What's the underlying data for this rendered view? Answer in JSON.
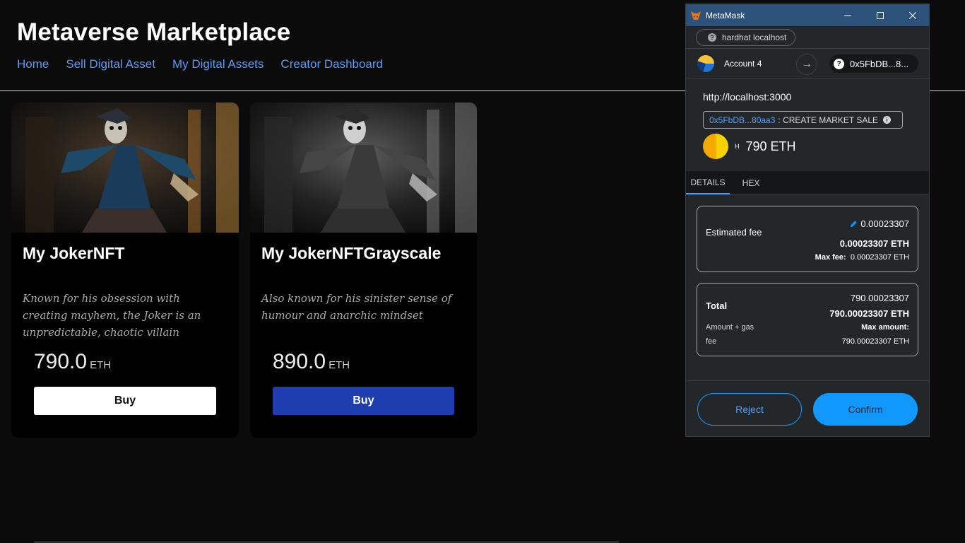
{
  "site": {
    "title": "Metaverse Marketplace",
    "nav": [
      "Home",
      "Sell Digital Asset",
      "My Digital Assets",
      "Creator Dashboard"
    ]
  },
  "cards": [
    {
      "name": "My JokerNFT",
      "description": "Known for his obsession with creating mayhem, the Joker is an unpredictable, chaotic villain",
      "price": "790.0",
      "unit": "ETH",
      "buy_label": "Buy"
    },
    {
      "name": "My JokerNFTGrayscale",
      "description": "Also known for his sinister sense of humour and anarchic mindset",
      "price": "890.0",
      "unit": "ETH",
      "buy_label": "Buy"
    }
  ],
  "metamask": {
    "window_title": "MetaMask",
    "network": "hardhat localhost",
    "from_account": "Account 4",
    "to_address": "0x5FbDB...8...",
    "origin": "http://localhost:3000",
    "method_address": "0x5FbDB...80aa3",
    "method_name": ": CREATE MARKET SALE",
    "value_prefix": "H",
    "value_amount": "790 ETH",
    "tabs": [
      "DETAILS",
      "HEX"
    ],
    "estimated_fee": {
      "label": "Estimated fee",
      "value": "0.00023307",
      "value_eth": "0.00023307 ETH",
      "max_fee_label": "Max fee:",
      "max_fee_value": "0.00023307 ETH"
    },
    "total": {
      "label": "Total",
      "value": "790.00023307",
      "value_eth": "790.00023307 ETH",
      "sub_label_1": "Amount + gas",
      "sub_label_2": "fee",
      "max_amount_label": "Max amount:",
      "max_amount_value": "790.00023307 ETH"
    },
    "reject_label": "Reject",
    "confirm_label": "Confirm"
  },
  "colors": {
    "accent_link": "#5a9bf6",
    "buy_blue": "#1e3eb0",
    "metamask_primary": "#1098fc",
    "titlebar": "#2d5279"
  }
}
